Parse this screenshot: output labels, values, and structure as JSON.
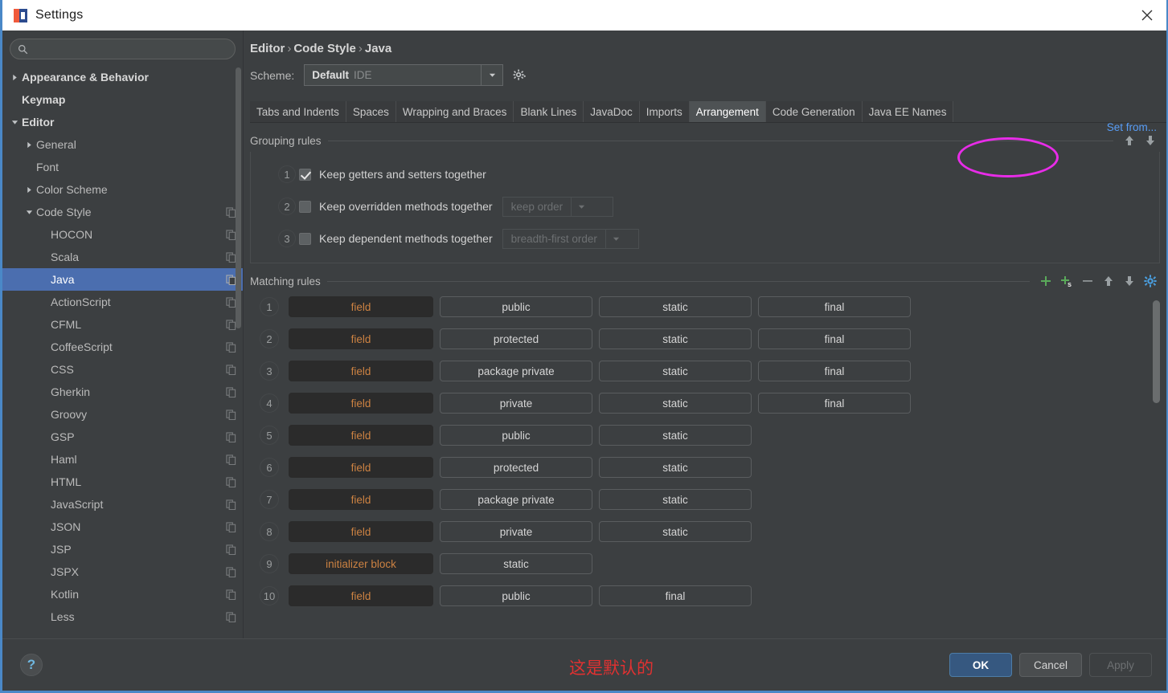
{
  "window": {
    "title": "Settings",
    "close_icon": "close-icon",
    "app_icon": "intellij-logo-icon"
  },
  "sidebar": {
    "search": {
      "value": "",
      "placeholder": "",
      "icon": "search-icon"
    },
    "items": [
      {
        "label": "Appearance & Behavior",
        "depth": 0,
        "twisty": "collapsed",
        "bold": true,
        "copy": false,
        "selected": false
      },
      {
        "label": "Keymap",
        "depth": 0,
        "twisty": "none",
        "bold": true,
        "copy": false,
        "selected": false
      },
      {
        "label": "Editor",
        "depth": 0,
        "twisty": "expanded",
        "bold": true,
        "copy": false,
        "selected": false
      },
      {
        "label": "General",
        "depth": 1,
        "twisty": "collapsed",
        "bold": false,
        "copy": false,
        "selected": false
      },
      {
        "label": "Font",
        "depth": 1,
        "twisty": "none",
        "bold": false,
        "copy": false,
        "selected": false
      },
      {
        "label": "Color Scheme",
        "depth": 1,
        "twisty": "collapsed",
        "bold": false,
        "copy": false,
        "selected": false
      },
      {
        "label": "Code Style",
        "depth": 1,
        "twisty": "expanded",
        "bold": false,
        "copy": true,
        "selected": false
      },
      {
        "label": "HOCON",
        "depth": 2,
        "twisty": "none",
        "bold": false,
        "copy": true,
        "selected": false
      },
      {
        "label": "Scala",
        "depth": 2,
        "twisty": "none",
        "bold": false,
        "copy": true,
        "selected": false
      },
      {
        "label": "Java",
        "depth": 2,
        "twisty": "none",
        "bold": false,
        "copy": true,
        "selected": true
      },
      {
        "label": "ActionScript",
        "depth": 2,
        "twisty": "none",
        "bold": false,
        "copy": true,
        "selected": false
      },
      {
        "label": "CFML",
        "depth": 2,
        "twisty": "none",
        "bold": false,
        "copy": true,
        "selected": false
      },
      {
        "label": "CoffeeScript",
        "depth": 2,
        "twisty": "none",
        "bold": false,
        "copy": true,
        "selected": false
      },
      {
        "label": "CSS",
        "depth": 2,
        "twisty": "none",
        "bold": false,
        "copy": true,
        "selected": false
      },
      {
        "label": "Gherkin",
        "depth": 2,
        "twisty": "none",
        "bold": false,
        "copy": true,
        "selected": false
      },
      {
        "label": "Groovy",
        "depth": 2,
        "twisty": "none",
        "bold": false,
        "copy": true,
        "selected": false
      },
      {
        "label": "GSP",
        "depth": 2,
        "twisty": "none",
        "bold": false,
        "copy": true,
        "selected": false
      },
      {
        "label": "Haml",
        "depth": 2,
        "twisty": "none",
        "bold": false,
        "copy": true,
        "selected": false
      },
      {
        "label": "HTML",
        "depth": 2,
        "twisty": "none",
        "bold": false,
        "copy": true,
        "selected": false
      },
      {
        "label": "JavaScript",
        "depth": 2,
        "twisty": "none",
        "bold": false,
        "copy": true,
        "selected": false
      },
      {
        "label": "JSON",
        "depth": 2,
        "twisty": "none",
        "bold": false,
        "copy": true,
        "selected": false
      },
      {
        "label": "JSP",
        "depth": 2,
        "twisty": "none",
        "bold": false,
        "copy": true,
        "selected": false
      },
      {
        "label": "JSPX",
        "depth": 2,
        "twisty": "none",
        "bold": false,
        "copy": true,
        "selected": false
      },
      {
        "label": "Kotlin",
        "depth": 2,
        "twisty": "none",
        "bold": false,
        "copy": true,
        "selected": false
      },
      {
        "label": "Less",
        "depth": 2,
        "twisty": "none",
        "bold": false,
        "copy": true,
        "selected": false
      }
    ]
  },
  "main": {
    "breadcrumb": {
      "parts": [
        "Editor",
        "Code Style",
        "Java"
      ],
      "separator": "›"
    },
    "scheme": {
      "label": "Scheme:",
      "value": "Default",
      "value_sub": "IDE",
      "arrow_icon": "chevron-down-icon",
      "gear_icon": "gear-icon"
    },
    "set_from_link": "Set from...",
    "tabs": [
      {
        "label": "Tabs and Indents",
        "active": false
      },
      {
        "label": "Spaces",
        "active": false
      },
      {
        "label": "Wrapping and Braces",
        "active": false
      },
      {
        "label": "Blank Lines",
        "active": false
      },
      {
        "label": "JavaDoc",
        "active": false
      },
      {
        "label": "Imports",
        "active": false
      },
      {
        "label": "Arrangement",
        "active": true
      },
      {
        "label": "Code Generation",
        "active": false
      },
      {
        "label": "Java EE Names",
        "active": false
      }
    ],
    "annotation_ellipse_color": "#e82ce8",
    "grouping": {
      "title": "Grouping rules",
      "actions": [
        {
          "icon": "move-up-icon"
        },
        {
          "icon": "move-down-icon"
        }
      ],
      "rows": [
        {
          "num": "1",
          "checked": true,
          "label": "Keep getters and setters together",
          "combo": null
        },
        {
          "num": "2",
          "checked": false,
          "label": "Keep overridden methods together",
          "combo": {
            "value": "keep order",
            "width": 138,
            "disabled": true
          }
        },
        {
          "num": "3",
          "checked": false,
          "label": "Keep dependent methods together",
          "combo": {
            "value": "breadth-first order",
            "width": 170,
            "disabled": true
          }
        }
      ]
    },
    "matching": {
      "title": "Matching rules",
      "actions": [
        {
          "icon": "add-icon"
        },
        {
          "icon": "add-section-icon"
        },
        {
          "icon": "remove-icon"
        },
        {
          "icon": "move-up-icon"
        },
        {
          "icon": "move-down-icon"
        },
        {
          "icon": "settings-gear-icon"
        }
      ],
      "rows": [
        {
          "num": "1",
          "type": "field",
          "modifiers": [
            "public",
            "static",
            "final"
          ]
        },
        {
          "num": "2",
          "type": "field",
          "modifiers": [
            "protected",
            "static",
            "final"
          ]
        },
        {
          "num": "3",
          "type": "field",
          "modifiers": [
            "package private",
            "static",
            "final"
          ]
        },
        {
          "num": "4",
          "type": "field",
          "modifiers": [
            "private",
            "static",
            "final"
          ]
        },
        {
          "num": "5",
          "type": "field",
          "modifiers": [
            "public",
            "static"
          ]
        },
        {
          "num": "6",
          "type": "field",
          "modifiers": [
            "protected",
            "static"
          ]
        },
        {
          "num": "7",
          "type": "field",
          "modifiers": [
            "package private",
            "static"
          ]
        },
        {
          "num": "8",
          "type": "field",
          "modifiers": [
            "private",
            "static"
          ]
        },
        {
          "num": "9",
          "type": "initializer block",
          "modifiers": [
            "static"
          ]
        },
        {
          "num": "10",
          "type": "field",
          "modifiers": [
            "public",
            "final"
          ]
        }
      ]
    }
  },
  "footer": {
    "help_label": "?",
    "annotation": "这是默认的",
    "buttons": [
      {
        "label": "OK",
        "style": "primary",
        "disabled": false
      },
      {
        "label": "Cancel",
        "style": "normal",
        "disabled": false
      },
      {
        "label": "Apply",
        "style": "disabled",
        "disabled": true
      }
    ]
  },
  "colors": {
    "accent_blue": "#4b6eaf",
    "link_blue": "#589df6",
    "token_orange": "#cc8242",
    "annotation_red": "#e03131",
    "ellipse_magenta": "#e82ce8",
    "window_bg": "#3c3f41"
  }
}
